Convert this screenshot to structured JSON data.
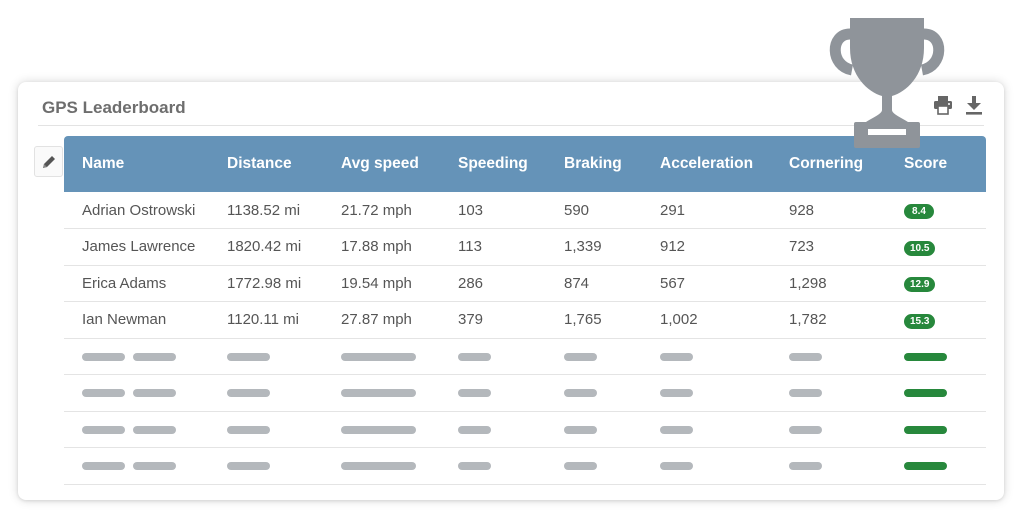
{
  "widget": {
    "title": "GPS Leaderboard",
    "icons": {
      "print": "printer-icon",
      "download": "download-icon",
      "edit": "pencil-icon",
      "decoration": "trophy-icon"
    }
  },
  "table": {
    "headers": [
      "Name",
      "Distance",
      "Avg speed",
      "Speeding",
      "Braking",
      "Acceleration",
      "Cornering",
      "Score"
    ],
    "rows": [
      {
        "name": "Adrian Ostrowski",
        "distance": "1138.52 mi",
        "avg_speed": "21.72 mph",
        "speeding": "103",
        "braking": "590",
        "acceleration": "291",
        "cornering": "928",
        "score": "8.4"
      },
      {
        "name": "James Lawrence",
        "distance": "1820.42 mi",
        "avg_speed": "17.88 mph",
        "speeding": "113",
        "braking": "1,339",
        "acceleration": "912",
        "cornering": "723",
        "score": "10.5"
      },
      {
        "name": "Erica Adams",
        "distance": "1772.98 mi",
        "avg_speed": "19.54 mph",
        "speeding": "286",
        "braking": "874",
        "acceleration": "567",
        "cornering": "1,298",
        "score": "12.9"
      },
      {
        "name": "Ian Newman",
        "distance": "1120.11 mi",
        "avg_speed": "27.87 mph",
        "speeding": "379",
        "braking": "1,765",
        "acceleration": "1,002",
        "cornering": "1,782",
        "score": "15.3"
      }
    ],
    "placeholder_row_count": 4
  },
  "colors": {
    "header_bg": "#6593b8",
    "score_badge": "#27883c",
    "placeholder": "#b4b8bc",
    "trophy": "#8f949a"
  }
}
